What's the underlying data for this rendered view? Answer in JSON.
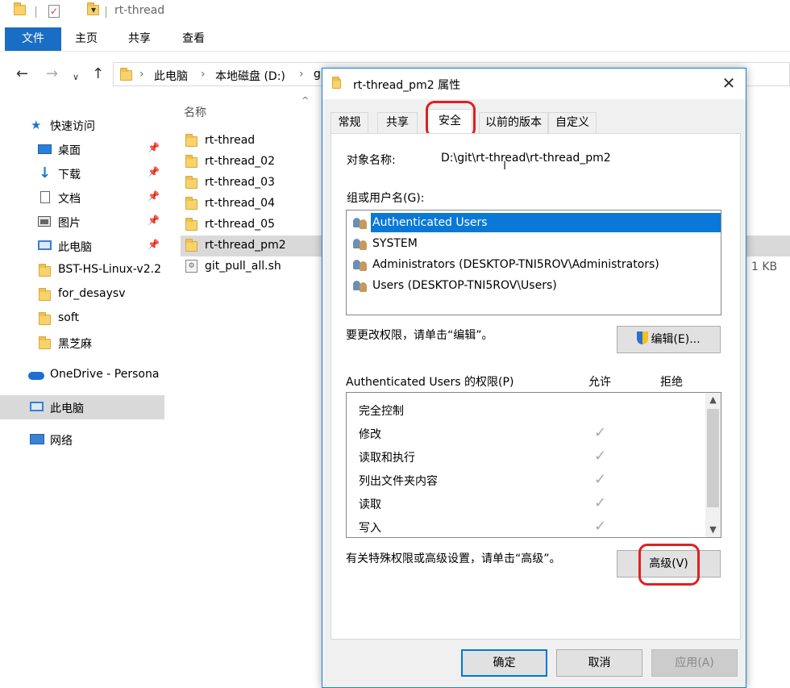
{
  "explorer": {
    "window_title": "rt-thread",
    "ribbon_tabs": [
      "文件",
      "主页",
      "共享",
      "查看"
    ],
    "breadcrumbs": [
      "此电脑",
      "本地磁盘 (D:)",
      "g"
    ],
    "nav": {
      "quick_access": "快速访问",
      "desktop": "桌面",
      "downloads": "下载",
      "documents": "文档",
      "pictures": "图片",
      "this_pc_pinned": "此电脑",
      "folder1": "BST-HS-Linux-v2.2",
      "folder2": "for_desaysv",
      "folder3": "soft",
      "folder4": "黑芝麻",
      "onedrive": "OneDrive - Persona",
      "this_pc": "此电脑",
      "network": "网络"
    },
    "column_name": "名称",
    "files": [
      "rt-thread",
      "rt-thread_02",
      "rt-thread_03",
      "rt-thread_04",
      "rt-thread_05",
      "rt-thread_pm2",
      "git_pull_all.sh"
    ],
    "script_size": "1 KB"
  },
  "dialog": {
    "title": "rt-thread_pm2 属性",
    "tabs": [
      "常规",
      "共享",
      "安全",
      "以前的版本",
      "自定义"
    ],
    "object_label": "对象名称:",
    "object_value": "D:\\git\\rt-thread\\rt-thread_pm2",
    "groups_label": "组或用户名(G):",
    "users": [
      "Authenticated Users",
      "SYSTEM",
      "Administrators (DESKTOP-TNI5ROV\\Administrators)",
      "Users (DESKTOP-TNI5ROV\\Users)"
    ],
    "edit_hint": "要更改权限，请单击“编辑”。",
    "edit_button": "编辑(E)...",
    "perm_header": "Authenticated Users 的权限(P)",
    "allow_header": "允许",
    "deny_header": "拒绝",
    "permissions": [
      "完全控制",
      "修改",
      "读取和执行",
      "列出文件夹内容",
      "读取",
      "写入"
    ],
    "advanced_hint": "有关特殊权限或高级设置，请单击“高级”。",
    "advanced_button": "高级(V)",
    "ok_button": "确定",
    "cancel_button": "取消",
    "apply_button": "应用(A)"
  },
  "colors": {
    "accent": "#0078d7",
    "highlight": "#e02020",
    "selection": "#0a78d7"
  }
}
